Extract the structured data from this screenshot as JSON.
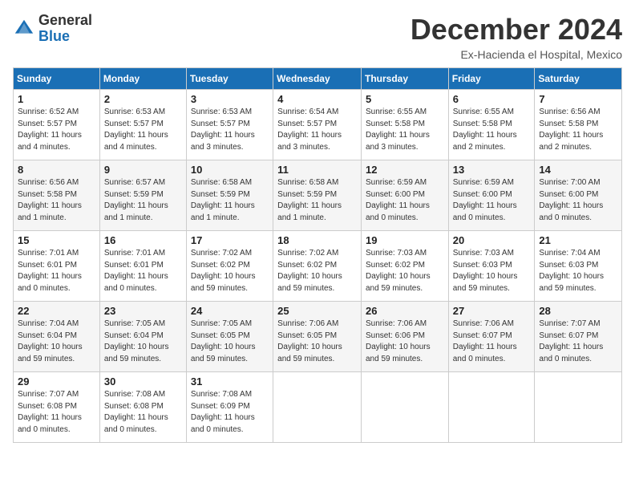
{
  "logo": {
    "general": "General",
    "blue": "Blue"
  },
  "title": "December 2024",
  "subtitle": "Ex-Hacienda el Hospital, Mexico",
  "days_of_week": [
    "Sunday",
    "Monday",
    "Tuesday",
    "Wednesday",
    "Thursday",
    "Friday",
    "Saturday"
  ],
  "weeks": [
    [
      {
        "day": "1",
        "info": "Sunrise: 6:52 AM\nSunset: 5:57 PM\nDaylight: 11 hours and 4 minutes."
      },
      {
        "day": "2",
        "info": "Sunrise: 6:53 AM\nSunset: 5:57 PM\nDaylight: 11 hours and 4 minutes."
      },
      {
        "day": "3",
        "info": "Sunrise: 6:53 AM\nSunset: 5:57 PM\nDaylight: 11 hours and 3 minutes."
      },
      {
        "day": "4",
        "info": "Sunrise: 6:54 AM\nSunset: 5:57 PM\nDaylight: 11 hours and 3 minutes."
      },
      {
        "day": "5",
        "info": "Sunrise: 6:55 AM\nSunset: 5:58 PM\nDaylight: 11 hours and 3 minutes."
      },
      {
        "day": "6",
        "info": "Sunrise: 6:55 AM\nSunset: 5:58 PM\nDaylight: 11 hours and 2 minutes."
      },
      {
        "day": "7",
        "info": "Sunrise: 6:56 AM\nSunset: 5:58 PM\nDaylight: 11 hours and 2 minutes."
      }
    ],
    [
      {
        "day": "8",
        "info": "Sunrise: 6:56 AM\nSunset: 5:58 PM\nDaylight: 11 hours and 1 minute."
      },
      {
        "day": "9",
        "info": "Sunrise: 6:57 AM\nSunset: 5:59 PM\nDaylight: 11 hours and 1 minute."
      },
      {
        "day": "10",
        "info": "Sunrise: 6:58 AM\nSunset: 5:59 PM\nDaylight: 11 hours and 1 minute."
      },
      {
        "day": "11",
        "info": "Sunrise: 6:58 AM\nSunset: 5:59 PM\nDaylight: 11 hours and 1 minute."
      },
      {
        "day": "12",
        "info": "Sunrise: 6:59 AM\nSunset: 6:00 PM\nDaylight: 11 hours and 0 minutes."
      },
      {
        "day": "13",
        "info": "Sunrise: 6:59 AM\nSunset: 6:00 PM\nDaylight: 11 hours and 0 minutes."
      },
      {
        "day": "14",
        "info": "Sunrise: 7:00 AM\nSunset: 6:00 PM\nDaylight: 11 hours and 0 minutes."
      }
    ],
    [
      {
        "day": "15",
        "info": "Sunrise: 7:01 AM\nSunset: 6:01 PM\nDaylight: 11 hours and 0 minutes."
      },
      {
        "day": "16",
        "info": "Sunrise: 7:01 AM\nSunset: 6:01 PM\nDaylight: 11 hours and 0 minutes."
      },
      {
        "day": "17",
        "info": "Sunrise: 7:02 AM\nSunset: 6:02 PM\nDaylight: 10 hours and 59 minutes."
      },
      {
        "day": "18",
        "info": "Sunrise: 7:02 AM\nSunset: 6:02 PM\nDaylight: 10 hours and 59 minutes."
      },
      {
        "day": "19",
        "info": "Sunrise: 7:03 AM\nSunset: 6:02 PM\nDaylight: 10 hours and 59 minutes."
      },
      {
        "day": "20",
        "info": "Sunrise: 7:03 AM\nSunset: 6:03 PM\nDaylight: 10 hours and 59 minutes."
      },
      {
        "day": "21",
        "info": "Sunrise: 7:04 AM\nSunset: 6:03 PM\nDaylight: 10 hours and 59 minutes."
      }
    ],
    [
      {
        "day": "22",
        "info": "Sunrise: 7:04 AM\nSunset: 6:04 PM\nDaylight: 10 hours and 59 minutes."
      },
      {
        "day": "23",
        "info": "Sunrise: 7:05 AM\nSunset: 6:04 PM\nDaylight: 10 hours and 59 minutes."
      },
      {
        "day": "24",
        "info": "Sunrise: 7:05 AM\nSunset: 6:05 PM\nDaylight: 10 hours and 59 minutes."
      },
      {
        "day": "25",
        "info": "Sunrise: 7:06 AM\nSunset: 6:05 PM\nDaylight: 10 hours and 59 minutes."
      },
      {
        "day": "26",
        "info": "Sunrise: 7:06 AM\nSunset: 6:06 PM\nDaylight: 10 hours and 59 minutes."
      },
      {
        "day": "27",
        "info": "Sunrise: 7:06 AM\nSunset: 6:07 PM\nDaylight: 11 hours and 0 minutes."
      },
      {
        "day": "28",
        "info": "Sunrise: 7:07 AM\nSunset: 6:07 PM\nDaylight: 11 hours and 0 minutes."
      }
    ],
    [
      {
        "day": "29",
        "info": "Sunrise: 7:07 AM\nSunset: 6:08 PM\nDaylight: 11 hours and 0 minutes."
      },
      {
        "day": "30",
        "info": "Sunrise: 7:08 AM\nSunset: 6:08 PM\nDaylight: 11 hours and 0 minutes."
      },
      {
        "day": "31",
        "info": "Sunrise: 7:08 AM\nSunset: 6:09 PM\nDaylight: 11 hours and 0 minutes."
      },
      {
        "day": "",
        "info": ""
      },
      {
        "day": "",
        "info": ""
      },
      {
        "day": "",
        "info": ""
      },
      {
        "day": "",
        "info": ""
      }
    ]
  ]
}
